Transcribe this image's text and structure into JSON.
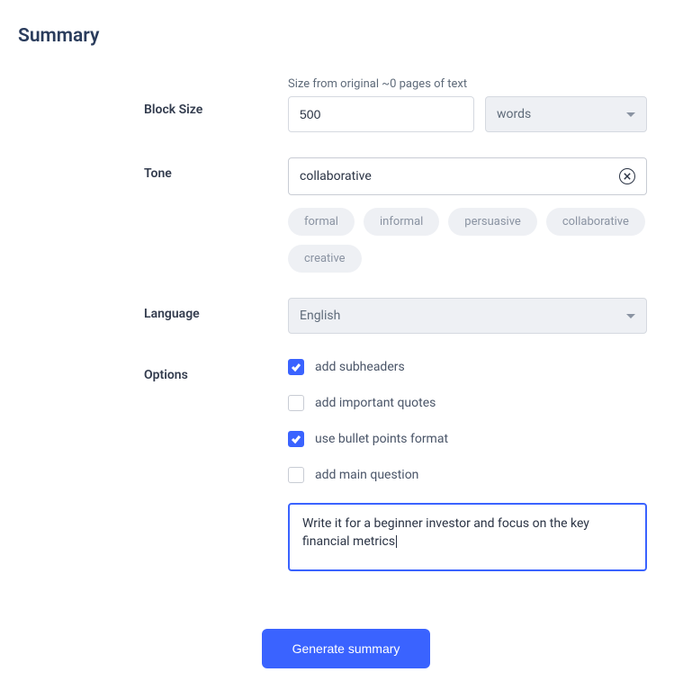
{
  "heading": "Summary",
  "blockSize": {
    "label": "Block Size",
    "hint": "Size from original ~0 pages of text",
    "value": "500",
    "unit": "words"
  },
  "tone": {
    "label": "Tone",
    "value": "collaborative",
    "chips": [
      "formal",
      "informal",
      "persuasive",
      "collaborative",
      "creative"
    ]
  },
  "language": {
    "label": "Language",
    "value": "English"
  },
  "options": {
    "label": "Options",
    "items": [
      {
        "label": "add subheaders",
        "checked": true
      },
      {
        "label": "add important quotes",
        "checked": false
      },
      {
        "label": "use bullet points format",
        "checked": true
      },
      {
        "label": "add main question",
        "checked": false
      }
    ],
    "custom": "Write it for a beginner investor and focus on the key financial metrics"
  },
  "generate": "Generate summary"
}
